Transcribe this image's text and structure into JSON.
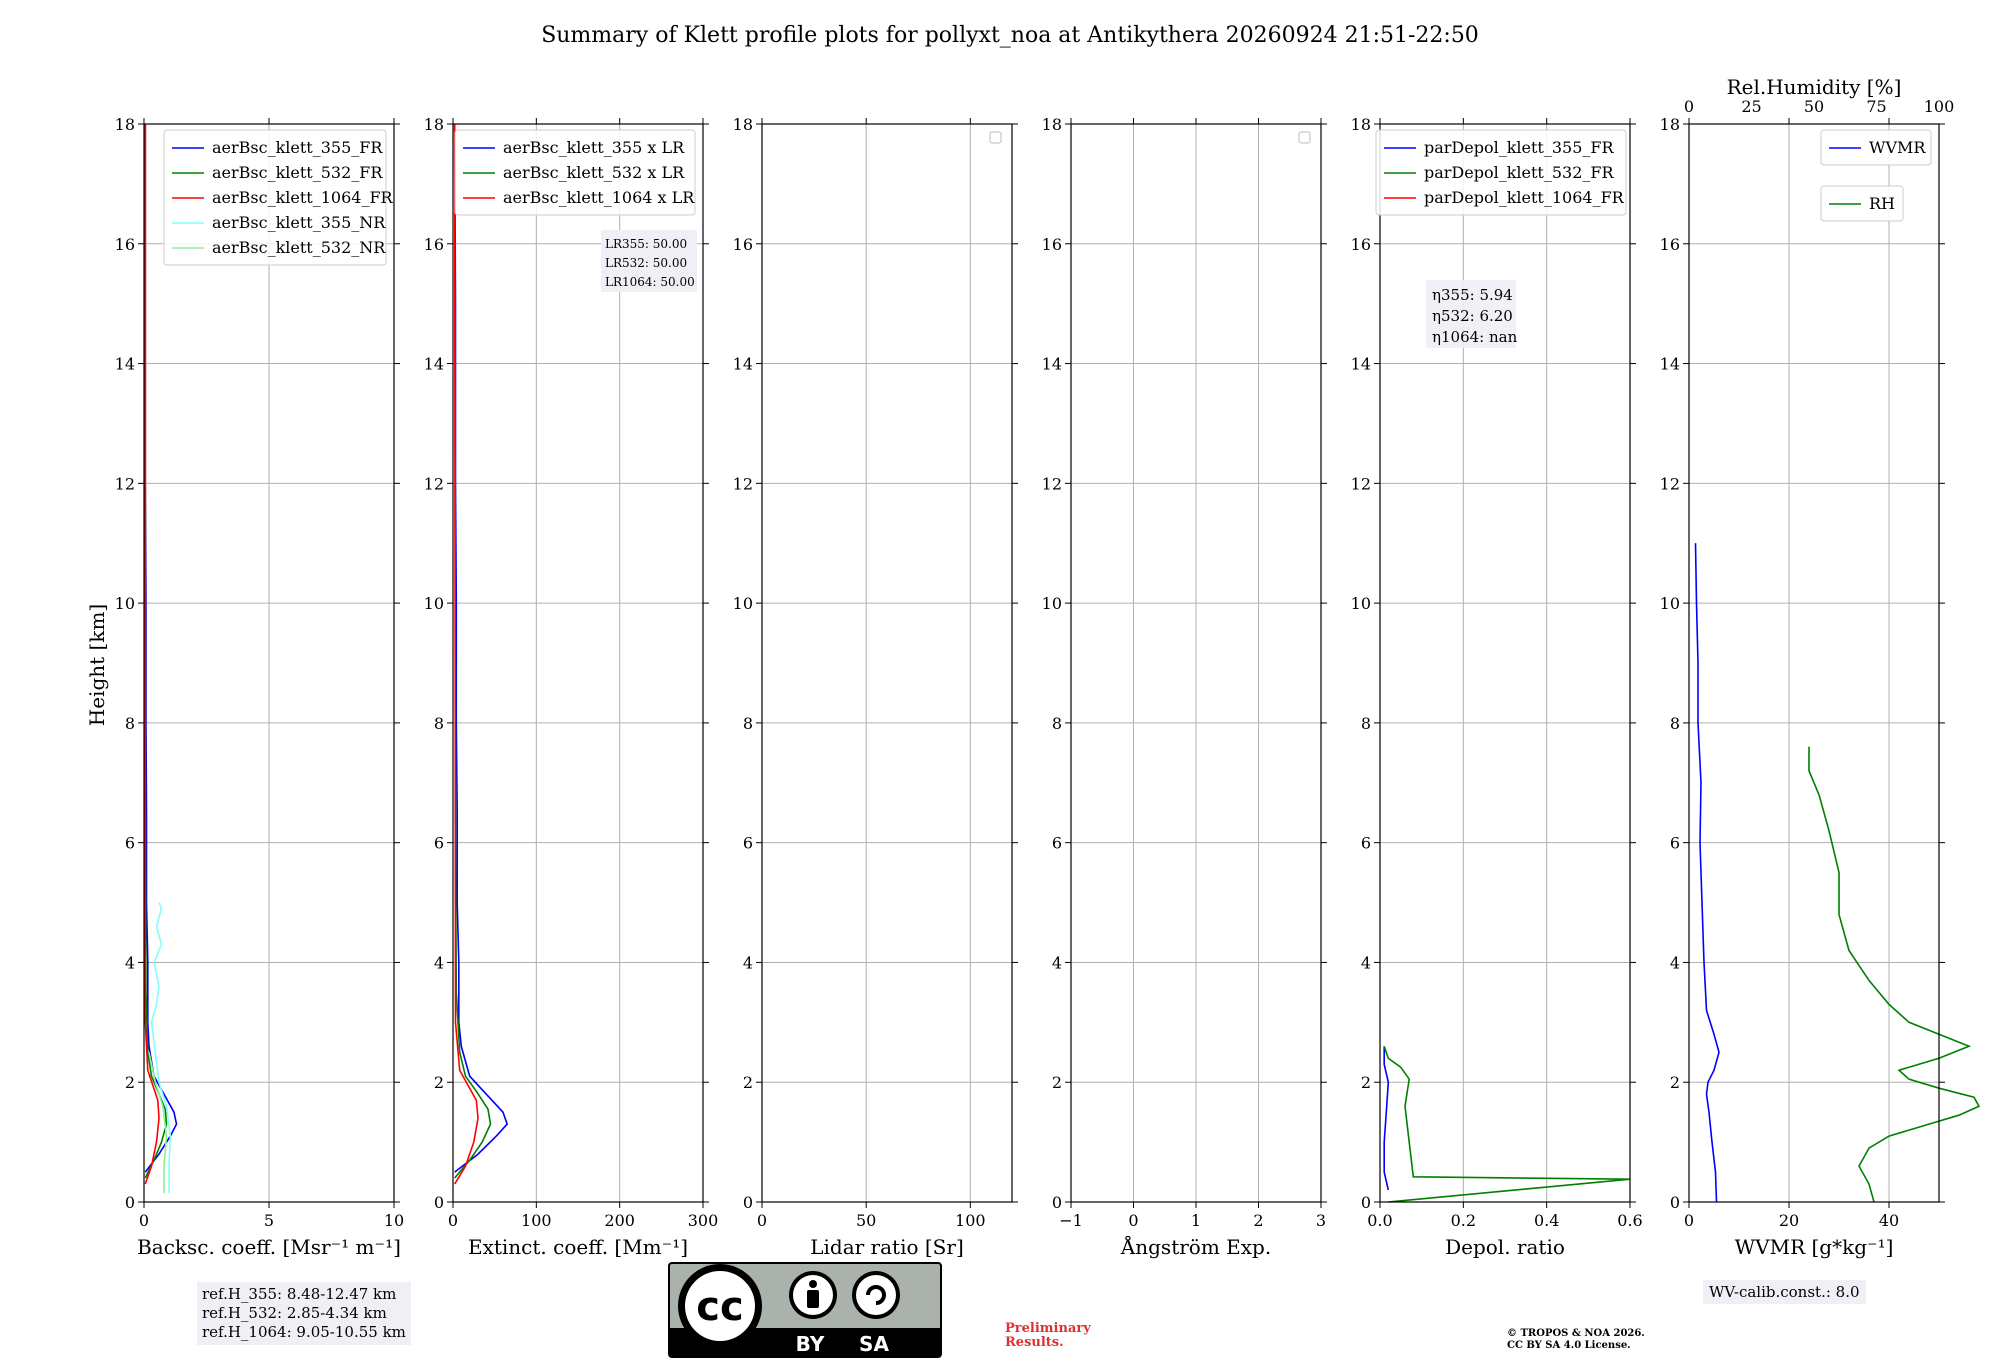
{
  "figure": {
    "title": "Summary of Klett profile plots for pollyxt_noa at Antikythera 20260924 21:51-22:50",
    "ylabel": "Height [km]"
  },
  "notes": {
    "refH": [
      "ref.H_355: 8.48-12.47 km",
      "ref.H_532: 2.85-4.34 km",
      "ref.H_1064: 9.05-10.55 km"
    ],
    "wv_calib": "WV-calib.const.: 8.0",
    "preliminary": [
      "Preliminary",
      "Results."
    ],
    "copyright": [
      "© TROPOS & NOA 2026.",
      "CC BY SA 4.0 License."
    ],
    "license_badge": {
      "cc": "cc",
      "by": "BY",
      "sa": "SA"
    }
  },
  "colors": {
    "blue": "#0000ff",
    "green": "#008000",
    "red": "#ff0000",
    "cyan": "#7fffff",
    "lightgreen": "#90ee90",
    "grid": "#b0b0b0"
  },
  "chart_data": [
    {
      "type": "line",
      "xlabel": "Backsc. coeff. [Msr⁻¹ m⁻¹]",
      "ylabel": "Height [km]",
      "xlim": [
        0,
        10
      ],
      "ylim": [
        0,
        18
      ],
      "xticks": [
        "0",
        "5",
        "10"
      ],
      "yticks": [
        "0",
        "2",
        "4",
        "6",
        "8",
        "10",
        "12",
        "14",
        "16",
        "18"
      ],
      "grid": true,
      "legend_position": "top-right",
      "series": [
        {
          "name": "aerBsc_klett_355_FR",
          "color": "#0000ff",
          "x": [
            0.05,
            0.6,
            1.05,
            1.3,
            1.2,
            0.8,
            0.4,
            0.2,
            0.15,
            0.15,
            0.1,
            0.1,
            0.08,
            0.08,
            0.05,
            0.05,
            0.05
          ],
          "y": [
            0.5,
            0.8,
            1.1,
            1.3,
            1.5,
            1.8,
            2.1,
            2.6,
            3.0,
            4.0,
            5.0,
            6.5,
            8.0,
            10.0,
            12.0,
            15.0,
            18.0
          ]
        },
        {
          "name": "aerBsc_klett_532_FR",
          "color": "#008000",
          "x": [
            0.05,
            0.4,
            0.7,
            0.9,
            0.85,
            0.55,
            0.3,
            0.15,
            0.08,
            0.05,
            0.05
          ],
          "y": [
            0.4,
            0.7,
            1.0,
            1.3,
            1.55,
            1.85,
            2.1,
            2.5,
            3.5,
            6.0,
            18.0
          ]
        },
        {
          "name": "aerBsc_klett_1064_FR",
          "color": "#ff0000",
          "x": [
            0.05,
            0.3,
            0.5,
            0.6,
            0.55,
            0.35,
            0.15,
            0.05,
            0.05
          ],
          "y": [
            0.3,
            0.6,
            1.0,
            1.4,
            1.7,
            1.95,
            2.2,
            3.0,
            18.0
          ]
        },
        {
          "name": "aerBsc_klett_355_NR",
          "color": "#7fffff",
          "x": [
            1.0,
            1.0,
            1.05,
            0.9,
            0.6,
            0.3,
            0.5,
            0.6,
            0.4,
            0.7,
            0.5,
            0.7,
            0.6
          ],
          "y": [
            0.15,
            0.6,
            1.1,
            1.6,
            2.0,
            3.0,
            3.3,
            3.6,
            4.0,
            4.3,
            4.6,
            4.9,
            5.0
          ]
        },
        {
          "name": "aerBsc_klett_532_NR",
          "color": "#90ee90",
          "x": [
            0.8,
            0.8,
            0.9,
            0.75,
            0.45,
            0.2
          ],
          "y": [
            0.15,
            0.6,
            1.1,
            1.6,
            2.0,
            2.5
          ]
        }
      ]
    },
    {
      "type": "line",
      "xlabel": "Extinct. coeff. [Mm⁻¹]",
      "xlim": [
        0,
        300
      ],
      "ylim": [
        0,
        18
      ],
      "xticks": [
        "0",
        "100",
        "200",
        "300"
      ],
      "yticks": [
        "0",
        "2",
        "4",
        "6",
        "8",
        "10",
        "12",
        "14",
        "16",
        "18"
      ],
      "grid": true,
      "legend_position": "top-right",
      "annotation": [
        "LR355: 50.00",
        "LR532: 50.00",
        "LR1064: 50.00"
      ],
      "series": [
        {
          "name": "aerBsc_klett_355 x LR",
          "color": "#0000ff",
          "x": [
            2,
            30,
            52,
            65,
            60,
            40,
            20,
            10,
            7,
            7,
            5,
            5,
            4,
            4,
            3,
            3,
            2
          ],
          "y": [
            0.5,
            0.8,
            1.1,
            1.3,
            1.5,
            1.8,
            2.1,
            2.6,
            3.0,
            4.0,
            5.0,
            6.5,
            8.0,
            10.0,
            12.0,
            15.0,
            18.0
          ]
        },
        {
          "name": "aerBsc_klett_532 x LR",
          "color": "#008000",
          "x": [
            2,
            20,
            35,
            45,
            42,
            28,
            15,
            8,
            4,
            3,
            2
          ],
          "y": [
            0.4,
            0.7,
            1.0,
            1.3,
            1.55,
            1.85,
            2.1,
            2.5,
            3.5,
            6.0,
            18.0
          ]
        },
        {
          "name": "aerBsc_klett_1064 x LR",
          "color": "#ff0000",
          "x": [
            2,
            15,
            25,
            30,
            28,
            18,
            8,
            3,
            2
          ],
          "y": [
            0.3,
            0.6,
            1.0,
            1.4,
            1.7,
            1.95,
            2.2,
            3.0,
            18.0
          ]
        }
      ]
    },
    {
      "type": "line",
      "xlabel": "Lidar ratio [Sr]",
      "xlim": [
        0,
        120
      ],
      "ylim": [
        0,
        18
      ],
      "xticks": [
        "0",
        "50",
        "100"
      ],
      "yticks": [
        "0",
        "2",
        "4",
        "6",
        "8",
        "10",
        "12",
        "14",
        "16",
        "18"
      ],
      "grid": true,
      "series": []
    },
    {
      "type": "line",
      "xlabel": "Ångström Exp.",
      "xlim": [
        -1,
        3
      ],
      "ylim": [
        0,
        18
      ],
      "xticks": [
        "−1",
        "0",
        "1",
        "2",
        "3"
      ],
      "yticks": [
        "0",
        "2",
        "4",
        "6",
        "8",
        "10",
        "12",
        "14",
        "16",
        "18"
      ],
      "grid": true,
      "series": []
    },
    {
      "type": "line",
      "xlabel": "Depol. ratio",
      "xlim": [
        0,
        0.6
      ],
      "ylim": [
        0,
        18
      ],
      "xticks": [
        "0.0",
        "0.2",
        "0.4",
        "0.6"
      ],
      "yticks": [
        "0",
        "2",
        "4",
        "6",
        "8",
        "10",
        "12",
        "14",
        "16",
        "18"
      ],
      "grid": true,
      "legend_position": "top-right",
      "annotation": [
        "η355: 5.94",
        "η532: 6.20",
        "η1064: nan"
      ],
      "series": [
        {
          "name": "parDepol_klett_355_FR",
          "color": "#0000ff",
          "x": [
            0.02,
            0.01,
            0.01,
            0.015,
            0.02,
            0.01,
            0.01
          ],
          "y": [
            0.2,
            0.5,
            1.0,
            1.5,
            2.0,
            2.3,
            2.6
          ]
        },
        {
          "name": "parDepol_klett_532_FR",
          "color": "#008000",
          "x": [
            0.02,
            0.6,
            0.08,
            0.07,
            0.06,
            0.07,
            0.05,
            0.02,
            0.01
          ],
          "y": [
            0.0,
            0.38,
            0.42,
            1.0,
            1.6,
            2.05,
            2.25,
            2.4,
            2.6
          ]
        },
        {
          "name": "parDepol_klett_1064_FR",
          "color": "#ff0000",
          "x": [],
          "y": []
        }
      ]
    },
    {
      "type": "line",
      "xlabel": "WVMR [g*kg⁻¹]",
      "x2label": "Rel.Humidity [%]",
      "xlim": [
        0,
        50
      ],
      "x2lim": [
        0,
        100
      ],
      "ylim": [
        0,
        18
      ],
      "xticks": [
        "0",
        "20",
        "40"
      ],
      "x2ticks": [
        "0",
        "25",
        "50",
        "75",
        "100"
      ],
      "yticks": [
        "0",
        "2",
        "4",
        "6",
        "8",
        "10",
        "12",
        "14",
        "16",
        "18"
      ],
      "grid": true,
      "series": [
        {
          "name": "WVMR",
          "color": "#0000ff",
          "x": [
            5.5,
            5.3,
            4.6,
            4.0,
            3.5,
            3.8,
            5.0,
            6.0,
            5.0,
            3.5,
            3.0,
            2.6,
            2.2,
            2.4,
            1.8,
            1.8,
            1.5,
            1.3
          ],
          "y": [
            0.0,
            0.5,
            1.0,
            1.5,
            1.8,
            2.0,
            2.2,
            2.5,
            2.8,
            3.2,
            4.0,
            5.0,
            6.0,
            7.0,
            8.0,
            9.0,
            10.0,
            11.0
          ]
        },
        {
          "name": "RH",
          "color": "#008000",
          "x": [
            37,
            36,
            34,
            36,
            40,
            48,
            54,
            58,
            57,
            50,
            44,
            42,
            50,
            56,
            50,
            44,
            40,
            36,
            32,
            30,
            30,
            28,
            26,
            24,
            24
          ],
          "y": [
            0.0,
            0.3,
            0.6,
            0.9,
            1.1,
            1.3,
            1.45,
            1.6,
            1.75,
            1.9,
            2.05,
            2.2,
            2.4,
            2.6,
            2.8,
            3.0,
            3.3,
            3.7,
            4.2,
            4.8,
            5.5,
            6.2,
            6.8,
            7.2,
            7.6
          ]
        }
      ]
    }
  ]
}
